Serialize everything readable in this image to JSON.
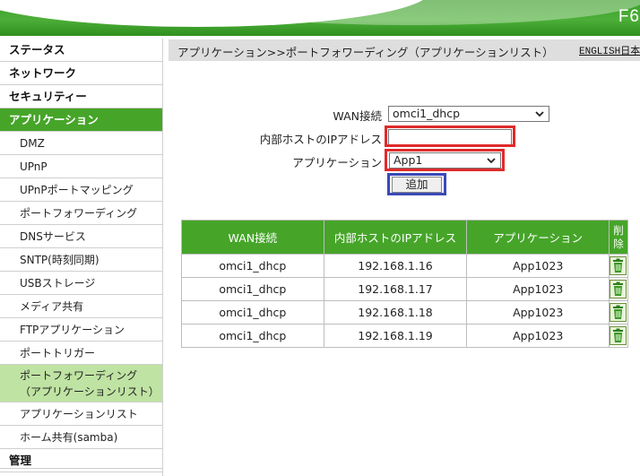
{
  "header": {
    "model": "F6"
  },
  "sidebar": {
    "items": [
      {
        "label": "ステータス",
        "level": "top",
        "active": false
      },
      {
        "label": "ネットワーク",
        "level": "top",
        "active": false
      },
      {
        "label": "セキュリティー",
        "level": "top",
        "active": false
      },
      {
        "label": "アプリケーション",
        "level": "top",
        "active": true
      },
      {
        "label": "DMZ",
        "level": "sub",
        "active": false
      },
      {
        "label": "UPnP",
        "level": "sub",
        "active": false
      },
      {
        "label": "UPnPポートマッピング",
        "level": "sub",
        "active": false
      },
      {
        "label": "ポートフォワーディング",
        "level": "sub",
        "active": false
      },
      {
        "label": "DNSサービス",
        "level": "sub",
        "active": false
      },
      {
        "label": "SNTP(時刻同期)",
        "level": "sub",
        "active": false
      },
      {
        "label": "USBストレージ",
        "level": "sub",
        "active": false
      },
      {
        "label": "メディア共有",
        "level": "sub",
        "active": false
      },
      {
        "label": "FTPアプリケーション",
        "level": "sub",
        "active": false
      },
      {
        "label": "ポートトリガー",
        "level": "sub",
        "active": false
      },
      {
        "label": "ポートフォワーディング（アプリケーションリスト）",
        "level": "sub",
        "active": true
      },
      {
        "label": "アプリケーションリスト",
        "level": "sub",
        "active": false
      },
      {
        "label": "ホーム共有(samba)",
        "level": "sub",
        "active": false
      },
      {
        "label": "管理",
        "level": "top",
        "active": false
      }
    ]
  },
  "breadcrumb": "アプリケーション>>ポートフォワーディング（アプリケーションリスト）",
  "language_link": "ENGLISH日本",
  "form": {
    "wan_label": "WAN接続",
    "wan_value": "omci1_dhcp",
    "host_label": "内部ホストのIPアドレス",
    "host_value": "",
    "app_label": "アプリケーション",
    "app_value": "App1",
    "add_button": "追加"
  },
  "table": {
    "headers": [
      "WAN接続",
      "内部ホストのIPアドレス",
      "アプリケーション",
      "削除"
    ],
    "rows": [
      [
        "omci1_dhcp",
        "192.168.1.16",
        "App1023"
      ],
      [
        "omci1_dhcp",
        "192.168.1.17",
        "App1023"
      ],
      [
        "omci1_dhcp",
        "192.168.1.18",
        "App1023"
      ],
      [
        "omci1_dhcp",
        "192.168.1.19",
        "App1023"
      ]
    ]
  },
  "colors": {
    "brand_green": "#46a529",
    "active_sub_bg": "#bfe3a3",
    "highlight_red": "#e02a2a",
    "highlight_blue": "#3a49b7"
  },
  "icons": {
    "delete": "trash-icon",
    "dropdown": "chevron-down-icon"
  }
}
